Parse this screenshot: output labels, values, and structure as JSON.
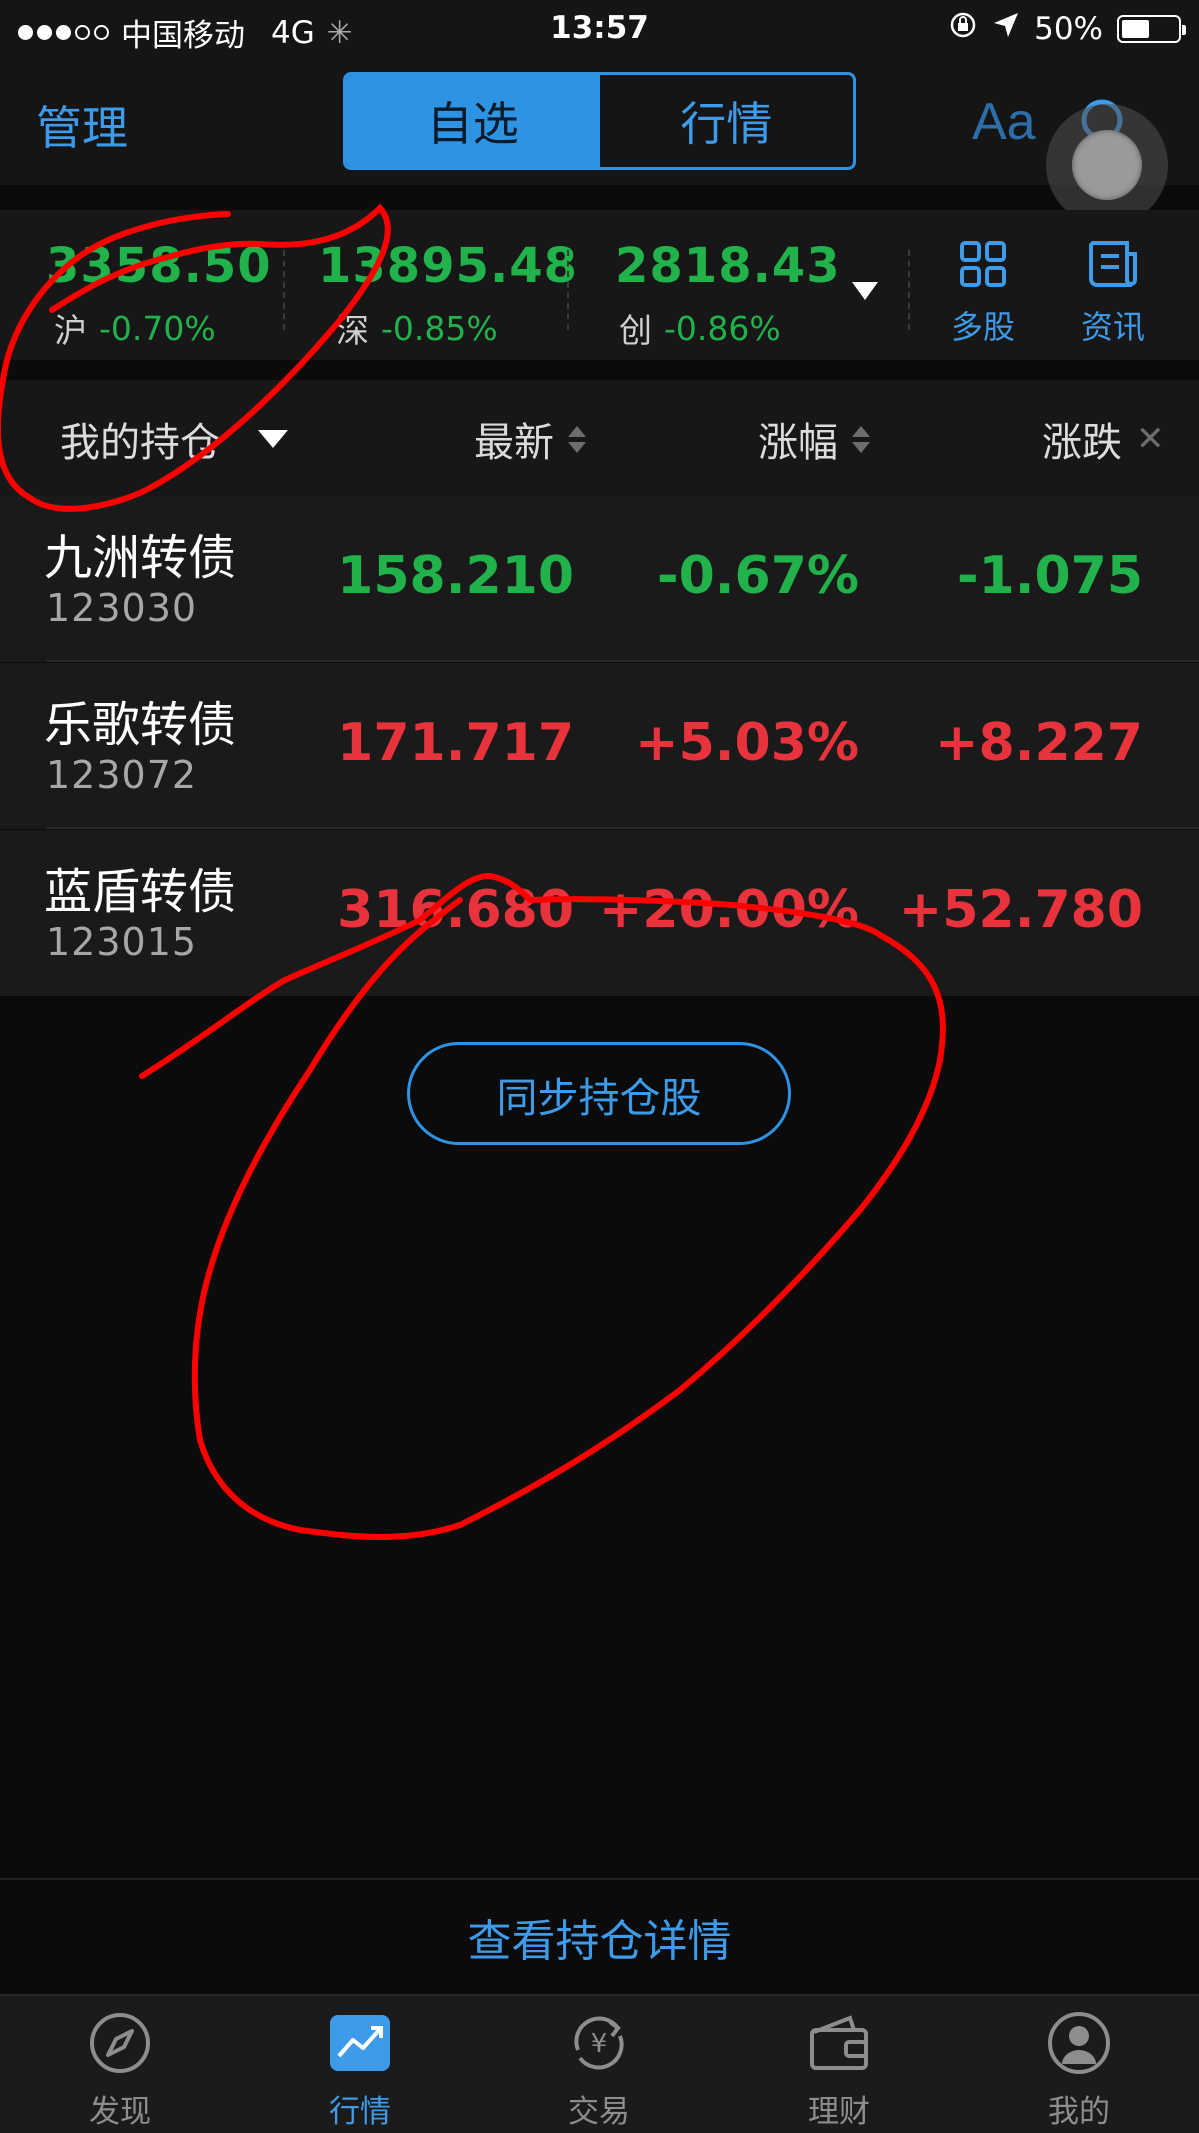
{
  "status_bar": {
    "carrier": "中国移动",
    "network": "4G",
    "time": "13:57",
    "battery": "50%",
    "battery_level": 0.5
  },
  "nav": {
    "manage": "管理",
    "tabs": [
      "自选",
      "行情"
    ],
    "active_tab": 0,
    "font_size_label": "Aa",
    "search_icon": "search-icon"
  },
  "indices": [
    {
      "value": "3358.50",
      "name": "沪",
      "change": "-0.70%"
    },
    {
      "value": "13895.48",
      "name": "深",
      "change": "-0.85%"
    },
    {
      "value": "2818.43",
      "name": "创",
      "change": "-0.86%"
    }
  ],
  "tools": [
    {
      "label": "多股",
      "icon": "grid-icon"
    },
    {
      "label": "资讯",
      "icon": "news-icon"
    }
  ],
  "table_header": {
    "group": "我的持仓",
    "latest": "最新",
    "change_pct": "涨幅",
    "change": "涨跌"
  },
  "rows": [
    {
      "name": "九洲转债",
      "code": "123030",
      "latest": "158.210",
      "change_pct": "-0.67%",
      "change": "-1.075",
      "trend": "down"
    },
    {
      "name": "乐歌转债",
      "code": "123072",
      "latest": "171.717",
      "change_pct": "+5.03%",
      "change": "+8.227",
      "trend": "up"
    },
    {
      "name": "蓝盾转债",
      "code": "123015",
      "latest": "316.680",
      "change_pct": "+20.00%",
      "change": "+52.780",
      "trend": "up"
    }
  ],
  "sync_button": "同步持仓股",
  "detail_link": "查看持仓详情",
  "tab_bar": [
    {
      "label": "发现",
      "icon": "compass-icon"
    },
    {
      "label": "行情",
      "icon": "chart-icon"
    },
    {
      "label": "交易",
      "icon": "yuan-exchange-icon"
    },
    {
      "label": "理财",
      "icon": "wallet-icon"
    },
    {
      "label": "我的",
      "icon": "user-icon"
    }
  ],
  "active_tab_bar": 1,
  "colors": {
    "accent": "#3d9be9",
    "up": "#e8333d",
    "down": "#21b24b",
    "annotation": "#ff0000"
  }
}
